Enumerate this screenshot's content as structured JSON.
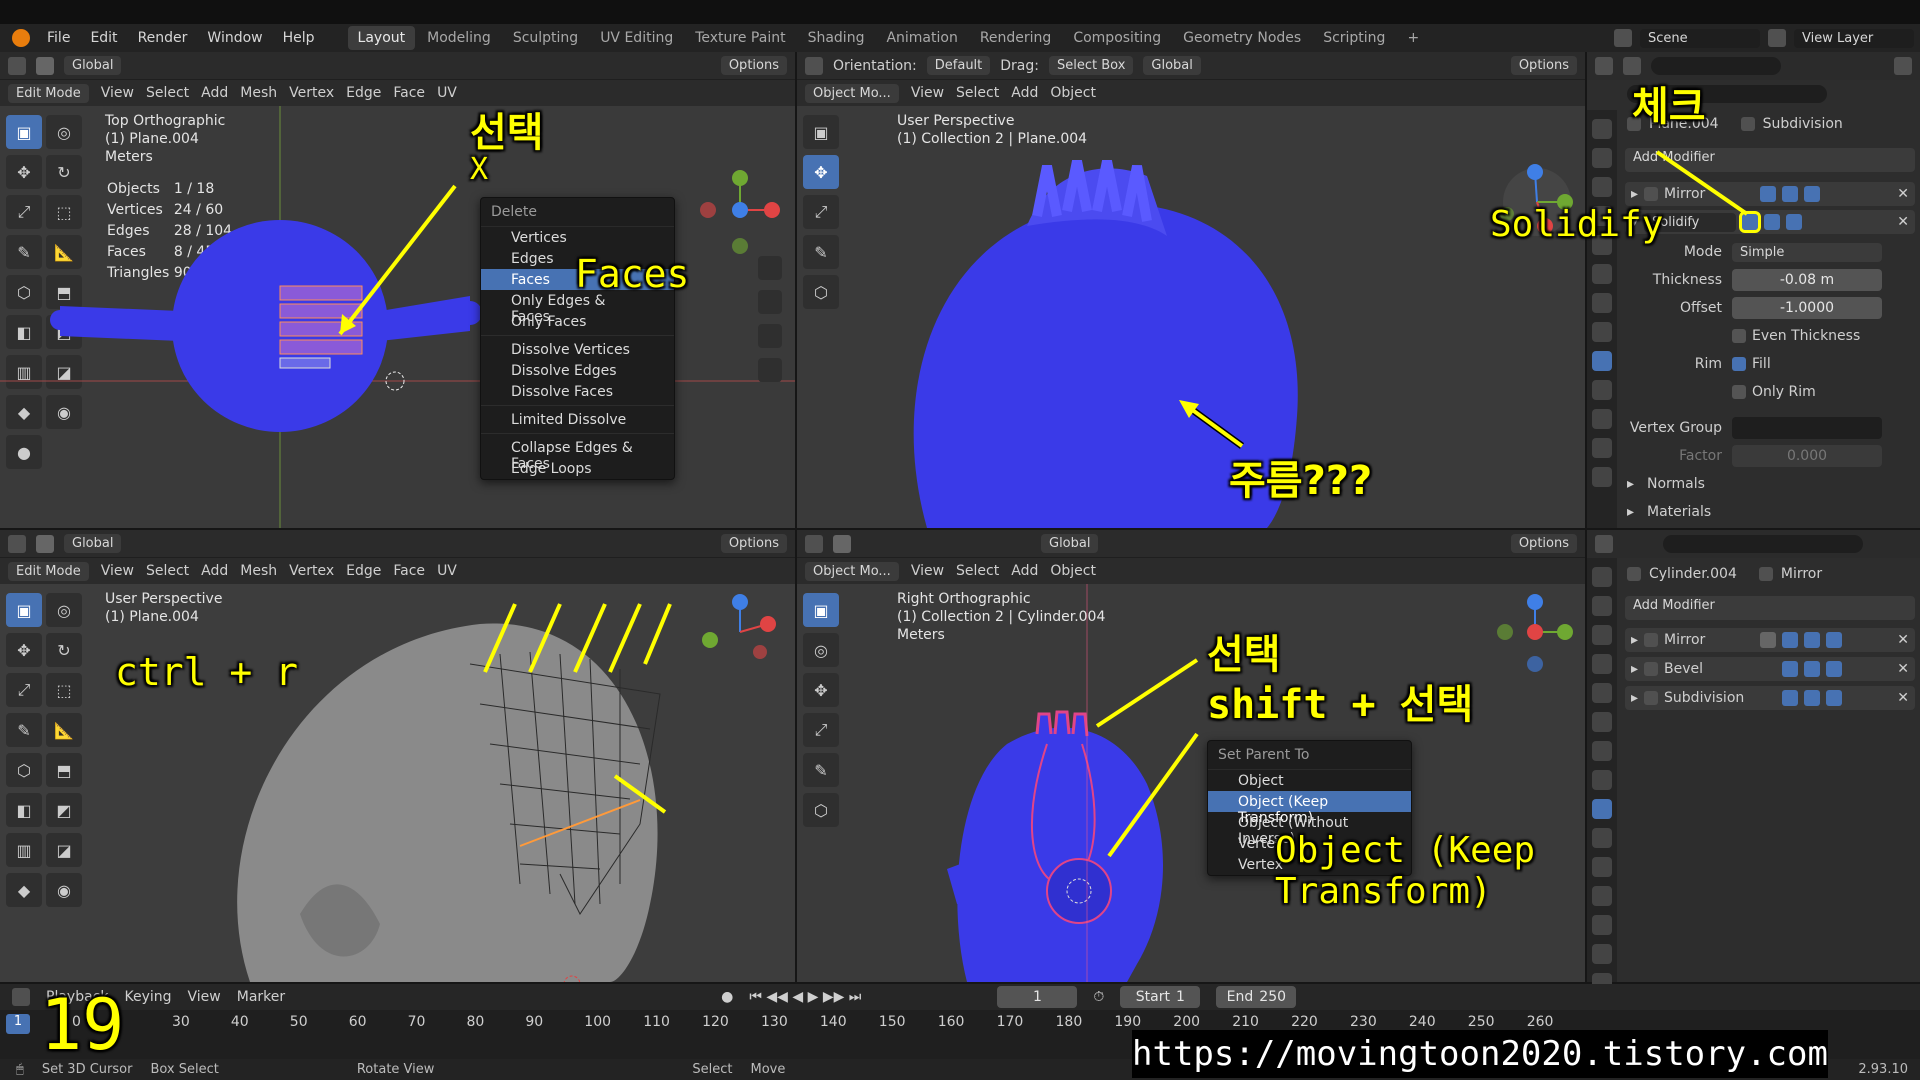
{
  "app": {
    "menus": [
      "File",
      "Edit",
      "Render",
      "Window",
      "Help"
    ],
    "workspaces": [
      "Layout",
      "Modeling",
      "Sculpting",
      "UV Editing",
      "Texture Paint",
      "Shading",
      "Animation",
      "Rendering",
      "Compositing",
      "Geometry Nodes",
      "Scripting"
    ],
    "active_workspace": "Layout",
    "scene": "Scene",
    "view_layer": "View Layer"
  },
  "vp1": {
    "mode": "Edit Mode",
    "menus": [
      "View",
      "Select",
      "Add",
      "Mesh",
      "Vertex",
      "Edge",
      "Face",
      "UV"
    ],
    "transform": "Global",
    "options": "Options",
    "title": "Top Orthographic",
    "object": "(1) Plane.004",
    "units": "Meters",
    "stats": [
      {
        "label": "Objects",
        "value": "1 / 18"
      },
      {
        "label": "Vertices",
        "value": "24 / 60"
      },
      {
        "label": "Edges",
        "value": "28 / 104"
      },
      {
        "label": "Faces",
        "value": "8 / 45"
      },
      {
        "label": "Triangles",
        "value": "90"
      }
    ],
    "delete_menu": {
      "title": "Delete",
      "items": [
        "Vertices",
        "Edges",
        "Faces",
        "Only Edges & Faces",
        "Only Faces",
        "Dissolve Vertices",
        "Dissolve Edges",
        "Dissolve Faces",
        "Limited Dissolve",
        "Collapse Edges & Faces",
        "Edge Loops"
      ],
      "selected": "Faces"
    },
    "notes": {
      "select": "선택",
      "x": "X",
      "faces": "Faces"
    }
  },
  "vp2": {
    "mode": "Object Mo...",
    "menus": [
      "View",
      "Select",
      "Add",
      "Object"
    ],
    "orientation_label": "Orientation:",
    "orientation": "Default",
    "drag_label": "Drag:",
    "drag": "Select Box",
    "transform": "Global",
    "options": "Options",
    "title": "User Perspective",
    "object": "(1) Collection 2 | Plane.004",
    "notes": {
      "wrinkle": "주름???"
    }
  },
  "vp3": {
    "mode": "Edit Mode",
    "menus": [
      "View",
      "Select",
      "Add",
      "Mesh",
      "Vertex",
      "Edge",
      "Face",
      "UV"
    ],
    "transform": "Global",
    "options": "Options",
    "title": "User Perspective",
    "object": "(1) Plane.004",
    "notes": {
      "shortcut": "ctrl + r"
    }
  },
  "vp4": {
    "mode": "Object Mo...",
    "menus": [
      "View",
      "Select",
      "Add",
      "Object"
    ],
    "transform": "Global",
    "options": "Options",
    "title": "Right Orthographic",
    "object": "(1) Collection 2 | Cylinder.004",
    "units": "Meters",
    "parent_menu": {
      "title": "Set Parent To",
      "items": [
        "Object",
        "Object (Keep Transform)",
        "Object (Without Inverse)",
        "Vertex",
        "Vertex"
      ],
      "selected": "Object (Keep Transform)"
    },
    "notes": {
      "select": "선택",
      "shift": "shift + 선택",
      "keep": "Object (Keep Transform)"
    }
  },
  "props1": {
    "object": "Plane.004",
    "modifier_name": "Subdivision",
    "add_modifier": "Add Modifier",
    "modifiers": [
      "Mirror",
      "Solidify"
    ],
    "solidify": {
      "mode_label": "Mode",
      "mode": "Simple",
      "thickness_label": "Thickness",
      "thickness": "-0.08 m",
      "offset_label": "Offset",
      "offset": "-1.0000",
      "even_thickness": "Even Thickness",
      "rim_label": "Rim",
      "fill": "Fill",
      "only_rim": "Only Rim",
      "vertex_group_label": "Vertex Group",
      "factor_label": "Factor",
      "factor": "0.000",
      "normals": "Normals",
      "materials": "Materials"
    },
    "notes": {
      "check": "체크",
      "solidify": "Solidify"
    }
  },
  "props2": {
    "object": "Cylinder.004",
    "modifier_name": "Mirror",
    "add_modifier": "Add Modifier",
    "modifiers": [
      "Mirror",
      "Bevel",
      "Subdivision"
    ]
  },
  "timeline": {
    "menus": [
      "Playback",
      "Keying",
      "View",
      "Marker"
    ],
    "frame": "1",
    "start_label": "Start",
    "start": "1",
    "end_label": "End",
    "end": "250",
    "ticks": [
      "0",
      "30",
      "40",
      "50",
      "60",
      "70",
      "80",
      "90",
      "100",
      "110",
      "120",
      "130",
      "140",
      "150",
      "160",
      "170",
      "180",
      "190",
      "200",
      "210",
      "220",
      "230",
      "240",
      "250",
      "260"
    ]
  },
  "status": {
    "items": [
      "Set 3D Cursor",
      "Box Select",
      "Rotate View",
      "Select",
      "Move"
    ],
    "version": "2.93.10"
  },
  "overlay": {
    "episode": "19",
    "url": "https://movingtoon2020.tistory.com"
  },
  "colors": {
    "accent": "#4772b3",
    "mesh": "#3a3ae8",
    "annotation": "#ffff00"
  }
}
